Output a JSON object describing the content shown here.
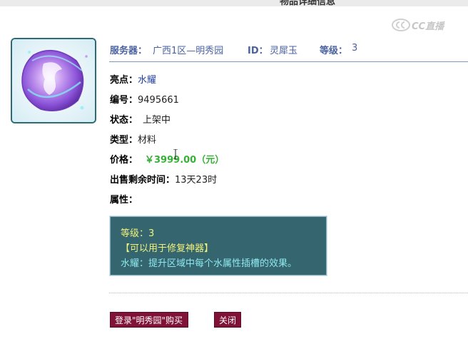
{
  "window": {
    "title": "物品详细信息"
  },
  "watermark": {
    "text": "CC直播"
  },
  "header": {
    "server_label": "服务器：",
    "server_value": "广西1区—明秀园",
    "id_label": "ID：",
    "id_value": "灵犀玉",
    "level_label": "等级：",
    "level_value": "3"
  },
  "details": {
    "highlight_label": "亮点：",
    "highlight_value": "水耀",
    "number_label": "编号：",
    "number_value": "9495661",
    "status_label": "状态：",
    "status_value": "上架中",
    "type_label": "类型：",
    "type_value": "材料",
    "price_label": "价格：",
    "price_value": "￥3999.00（元）",
    "time_label": "出售剩余时间：",
    "time_value": "13天23时",
    "attr_label": "属性："
  },
  "tooltip": {
    "level": "等级：3",
    "usage": "【可以用于修复神器】",
    "effect": "水耀：提升区域中每个水属性插槽的效果。"
  },
  "buttons": {
    "buy": "登录\"明秀园\"购买",
    "close": "关闭"
  },
  "icons": {
    "item": "purple-crystal-gem-icon",
    "watermark_logo": "cc-logo-icon"
  }
}
